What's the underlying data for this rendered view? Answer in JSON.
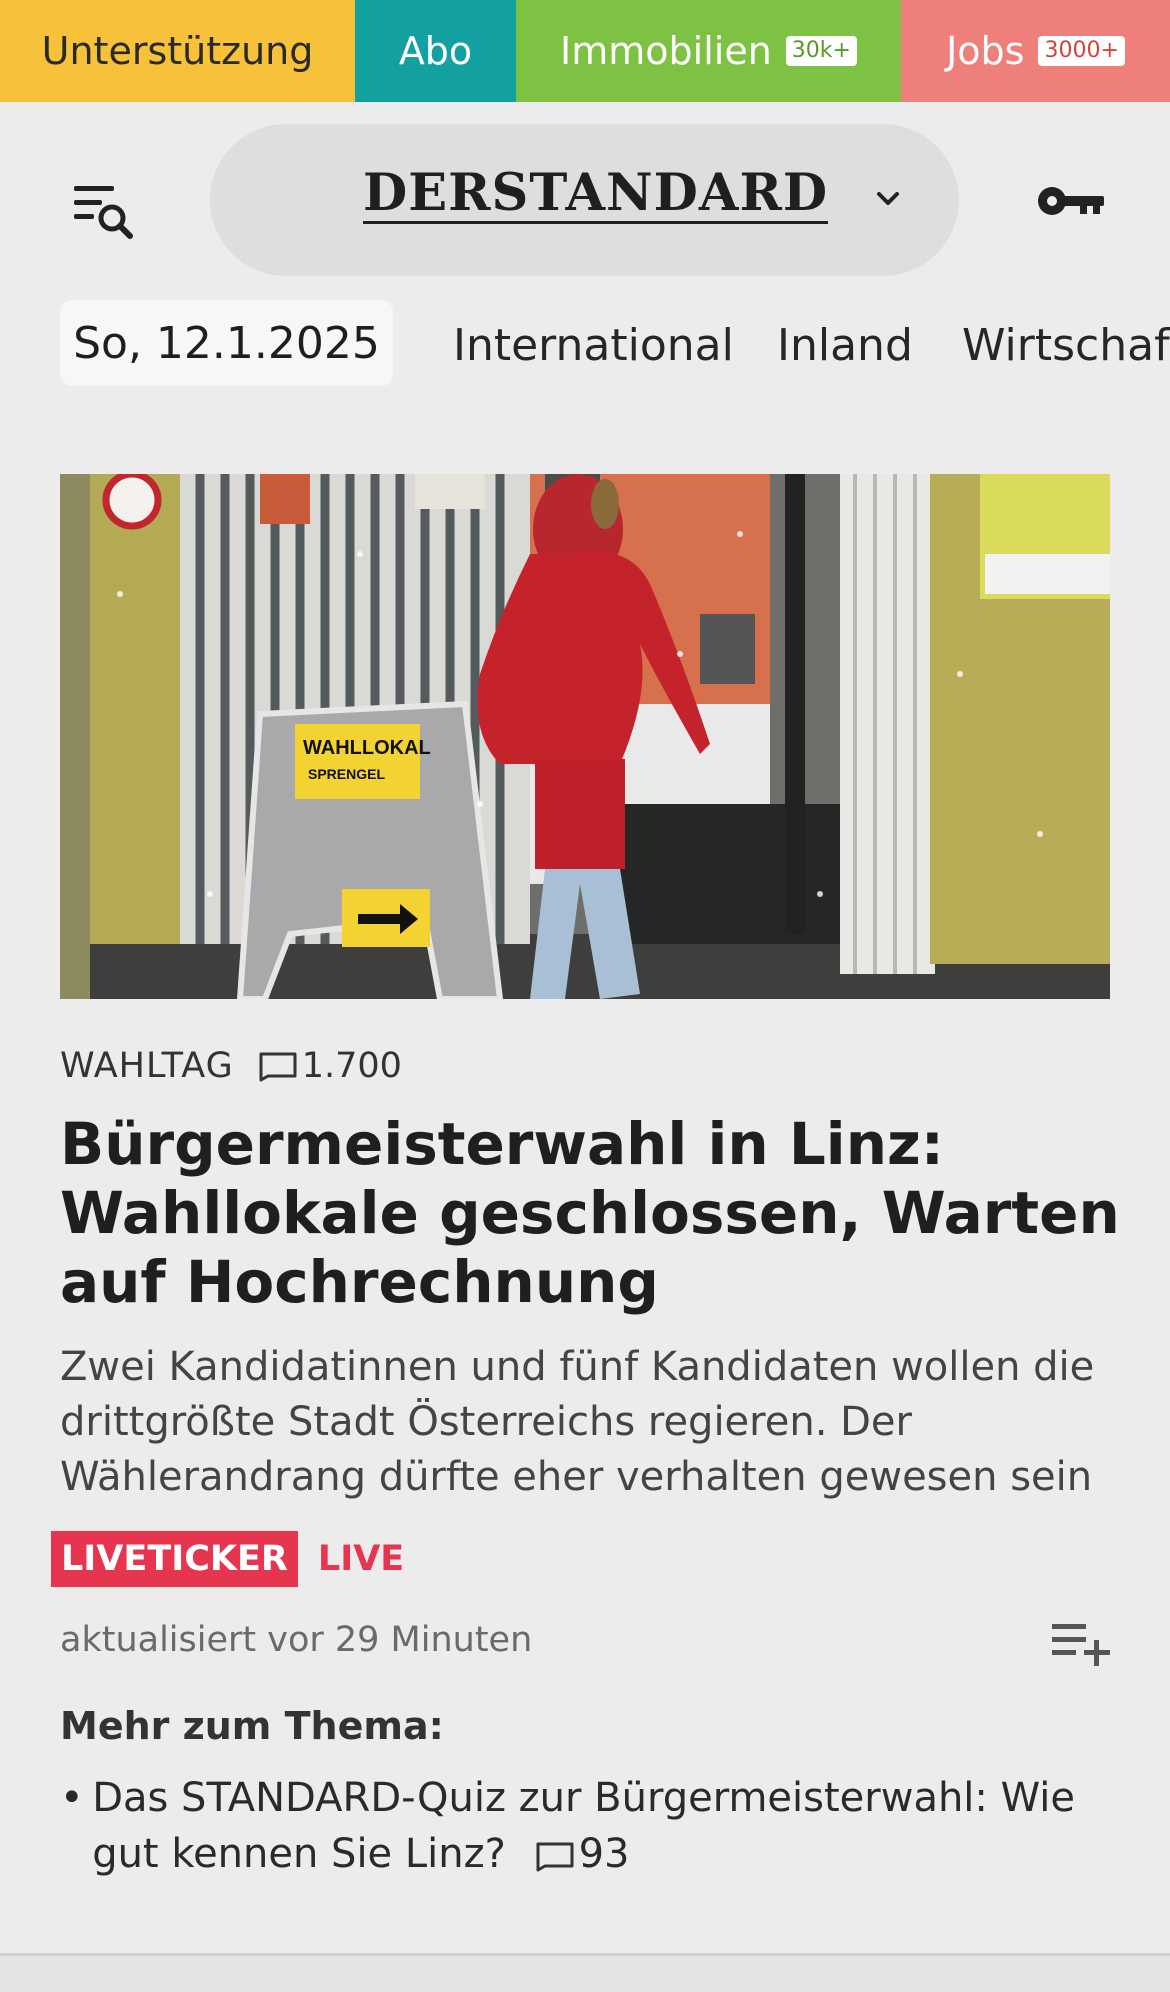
{
  "topbar": {
    "support": "Unterstützung",
    "abo": "Abo",
    "immo_label": "Immobilien",
    "immo_badge": "30k+",
    "jobs_label": "Jobs",
    "jobs_badge": "3000+",
    "colors": {
      "support": "#f8c13a",
      "abo": "#12a1a0",
      "immo": "#7dc242",
      "jobs": "#ee7f7a"
    }
  },
  "header": {
    "logo": "DERSTANDARD",
    "icons": [
      "menu-search-icon",
      "chevron-down-icon",
      "key-icon"
    ]
  },
  "nav": {
    "date": "So, 12.1.2025",
    "items": [
      "International",
      "Inland",
      "Wirtschaft"
    ]
  },
  "article": {
    "image_sign_title": "WAHLLOKAL",
    "image_sign_sub": "SPRENGEL",
    "kicker": "WAHLTAG",
    "comments": "1.700",
    "headline": "Bürgermeisterwahl in Linz: Wahllokale geschlossen, Warten auf Hochrechnung",
    "teaser": "Zwei Kandidatinnen und fünf Kandidaten wollen die drittgrößte Stadt Österreichs regieren. Der Wählerandrang dürfte eher verhalten gewesen sein",
    "live_badge": "LIVETICKER",
    "live_label": "LIVE",
    "updated": "aktualisiert vor 29 Minuten",
    "accent": "#e5354f"
  },
  "more": {
    "title": "Mehr zum Thema:",
    "items": [
      {
        "text": "Das STANDARD-Quiz zur Bürgermeisterwahl: Wie gut kennen Sie Linz?",
        "comments": "93"
      }
    ]
  }
}
